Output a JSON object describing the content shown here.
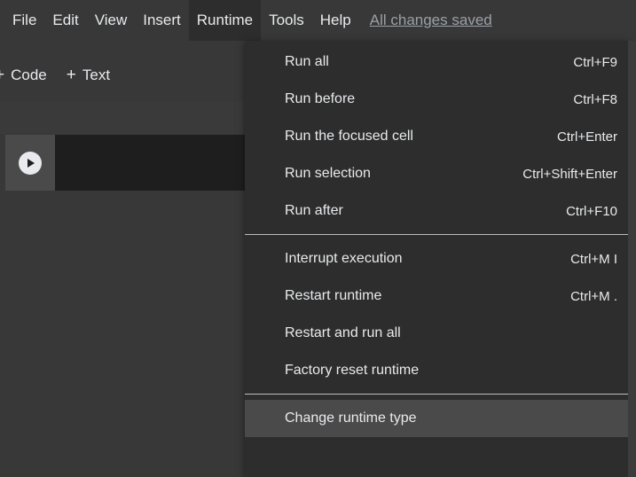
{
  "menubar": {
    "items": [
      "File",
      "Edit",
      "View",
      "Insert",
      "Runtime",
      "Tools",
      "Help"
    ],
    "status_link": "All changes saved"
  },
  "toolbar": {
    "code_label": "Code",
    "text_label": "Text"
  },
  "runtime_menu": {
    "sections": [
      [
        {
          "label": "Run all",
          "shortcut": "Ctrl+F9"
        },
        {
          "label": "Run before",
          "shortcut": "Ctrl+F8"
        },
        {
          "label": "Run the focused cell",
          "shortcut": "Ctrl+Enter"
        },
        {
          "label": "Run selection",
          "shortcut": "Ctrl+Shift+Enter"
        },
        {
          "label": "Run after",
          "shortcut": "Ctrl+F10"
        }
      ],
      [
        {
          "label": "Interrupt execution",
          "shortcut": "Ctrl+M I"
        },
        {
          "label": "Restart runtime",
          "shortcut": "Ctrl+M ."
        },
        {
          "label": "Restart and run all",
          "shortcut": ""
        },
        {
          "label": "Factory reset runtime",
          "shortcut": ""
        }
      ],
      [
        {
          "label": "Change runtime type",
          "shortcut": ""
        }
      ]
    ],
    "highlighted": "Change runtime type"
  },
  "colors": {
    "background": "#383838",
    "menu_bg": "#2d2d2d",
    "cell_bg": "#1e1e1e",
    "text": "#e8eaed"
  }
}
